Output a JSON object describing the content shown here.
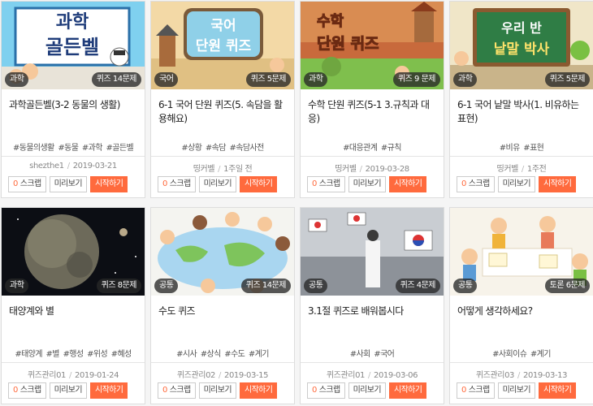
{
  "cards": [
    {
      "banner": "과학 골든벨",
      "category": "과학",
      "count": "퀴즈 14문제",
      "title": "과학골든벨(3-2 동물의 생활)",
      "tags": [
        "#동물의생활",
        "#동물",
        "#과학",
        "#골든벨"
      ],
      "author": "shezthe1",
      "date": "2019-03-21",
      "scrap": "0",
      "scrap_label": "스크랩",
      "preview_label": "미리보기",
      "start_label": "시작하기"
    },
    {
      "banner": "국어 단원 퀴즈",
      "category": "국어",
      "count": "퀴즈 5문제",
      "title": "6-1 국어 단원 퀴즈(5. 속담을 활용해요)",
      "tags": [
        "#상황",
        "#속담",
        "#속담사전"
      ],
      "author": "띵커벨",
      "date": "1주일 전",
      "scrap": "0",
      "scrap_label": "스크랩",
      "preview_label": "미리보기",
      "start_label": "시작하기"
    },
    {
      "banner": "수학 단원 퀴즈",
      "category": "과학",
      "count": "퀴즈 9 문제",
      "title": "수학 단원 퀴즈(5-1 3.규칙과 대응)",
      "tags": [
        "#대응관계",
        "#규칙"
      ],
      "author": "띵커벨",
      "date": "2019-03-28",
      "scrap": "0",
      "scrap_label": "스크랩",
      "preview_label": "미리보기",
      "start_label": "시작하기"
    },
    {
      "banner": "우리 반 낱말 박사",
      "category": "과학",
      "count": "퀴즈 5문제",
      "title": "6-1 국어 낱말 박사(1. 비유하는 표현)",
      "tags": [
        "#비유",
        "#표현"
      ],
      "author": "띵커벨",
      "date": "1주전",
      "scrap": "0",
      "scrap_label": "스크랩",
      "preview_label": "미리보기",
      "start_label": "시작하기"
    },
    {
      "banner": "",
      "category": "과학",
      "count": "퀴즈 8문제",
      "title": "태양계와 별",
      "tags": [
        "#태양계",
        "#별",
        "#행성",
        "#위성",
        "#혜성"
      ],
      "author": "퀴즈관리01",
      "date": "2019-01-24",
      "scrap": "0",
      "scrap_label": "스크랩",
      "preview_label": "미리보기",
      "start_label": "시작하기"
    },
    {
      "banner": "",
      "category": "공통",
      "count": "퀴즈 14문제",
      "title": "수도 퀴즈",
      "tags": [
        "#시사",
        "#상식",
        "#수도",
        "#계기"
      ],
      "author": "퀴즈관리02",
      "date": "2019-03-15",
      "scrap": "0",
      "scrap_label": "스크랩",
      "preview_label": "미리보기",
      "start_label": "시작하기"
    },
    {
      "banner": "",
      "category": "공통",
      "count": "퀴즈 4문제",
      "title": "3.1절 퀴즈로 배워봅시다",
      "tags": [
        "#사회",
        "#국어"
      ],
      "author": "퀴즈관리01",
      "date": "2019-03-06",
      "scrap": "0",
      "scrap_label": "스크랩",
      "preview_label": "미리보기",
      "start_label": "시작하기"
    },
    {
      "banner": "",
      "category": "공통",
      "count": "토론 6문제",
      "title": "어떻게 생각하세요?",
      "tags": [
        "#사회이슈",
        "#계기"
      ],
      "author": "퀴즈관리03",
      "date": "2019-03-13",
      "scrap": "0",
      "scrap_label": "스크랩",
      "preview_label": "미리보기",
      "start_label": "시작하기"
    }
  ]
}
